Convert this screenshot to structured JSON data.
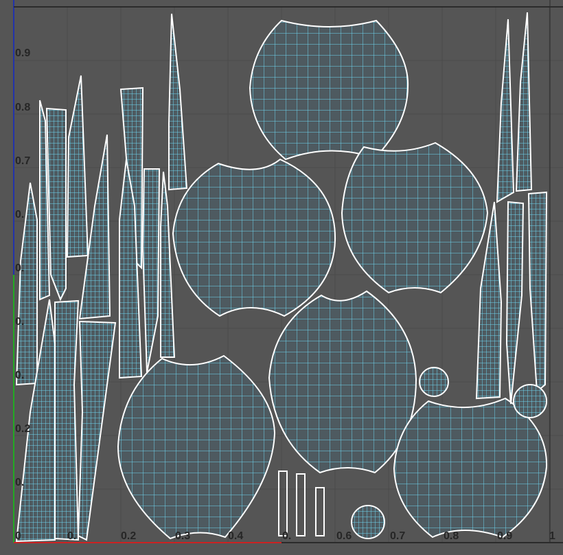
{
  "viewport": {
    "colors": {
      "background": "#555555",
      "grid": "#4a4a4a",
      "border": "#2b2b2b",
      "shell_fill": "#4e5a60",
      "shell_outline": "#ffffff",
      "mesh_wire": "#6fd6f0",
      "u_axis": "#cc2222",
      "v_axis": "#22aa22",
      "frame_axis": "#2233aa"
    }
  },
  "axis": {
    "x_labels": [
      "0.",
      "0.2",
      "0.3",
      "0.4",
      "0.",
      "0.6",
      "0.7",
      "0.8",
      "0.9",
      "1"
    ],
    "y_labels": [
      "0.9",
      "0.8",
      "0.7",
      "0.",
      "0.",
      "0.",
      "0.",
      "0.2",
      "0."
    ],
    "origin_label": "0"
  },
  "uv_shells": {
    "sphere_caps": 6,
    "strips": 20,
    "small_discs": 3,
    "bars": 3
  }
}
